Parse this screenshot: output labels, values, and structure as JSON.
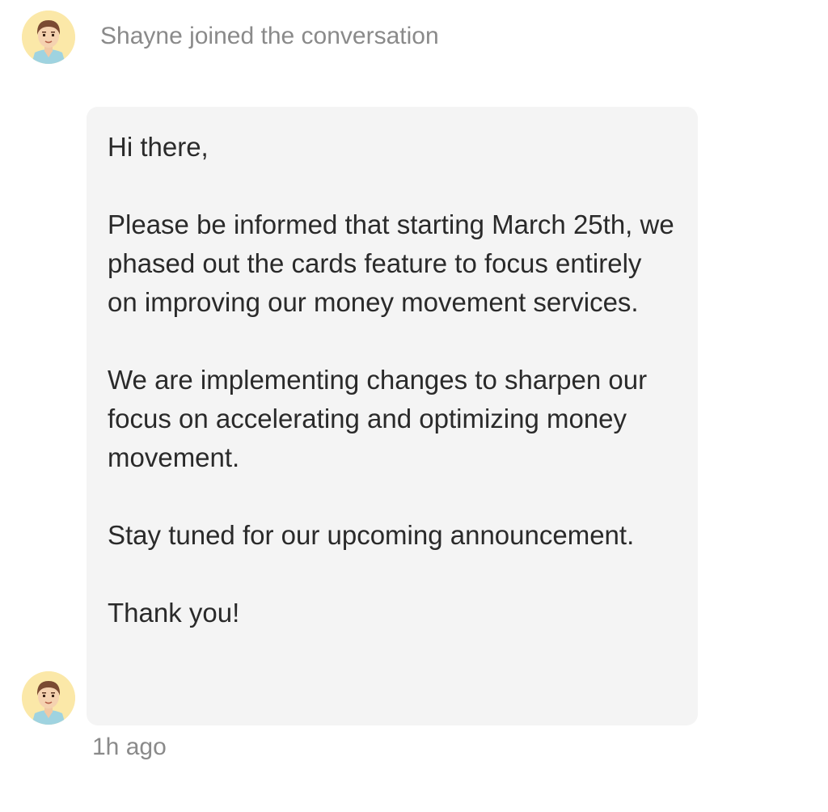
{
  "conversation": {
    "system_message": "Shayne joined the conversation",
    "message": {
      "paragraphs": [
        "Hi there,",
        "Please be informed that starting March 25th, we phased out the cards feature to focus entirely on improving our money movement services.",
        "We are implementing changes to sharpen our focus on accelerating and optimizing money movement.",
        "Stay tuned for our upcoming announcement.",
        "Thank you!"
      ],
      "timestamp": "1h ago"
    },
    "agent": {
      "avatar_icon": "cartoon-agent-avatar",
      "avatar_bg": "#fbe8a8"
    },
    "colors": {
      "bubble_bg": "#f4f4f4",
      "meta_text": "#8a8a8a",
      "body_text": "#2a2a2a"
    }
  }
}
